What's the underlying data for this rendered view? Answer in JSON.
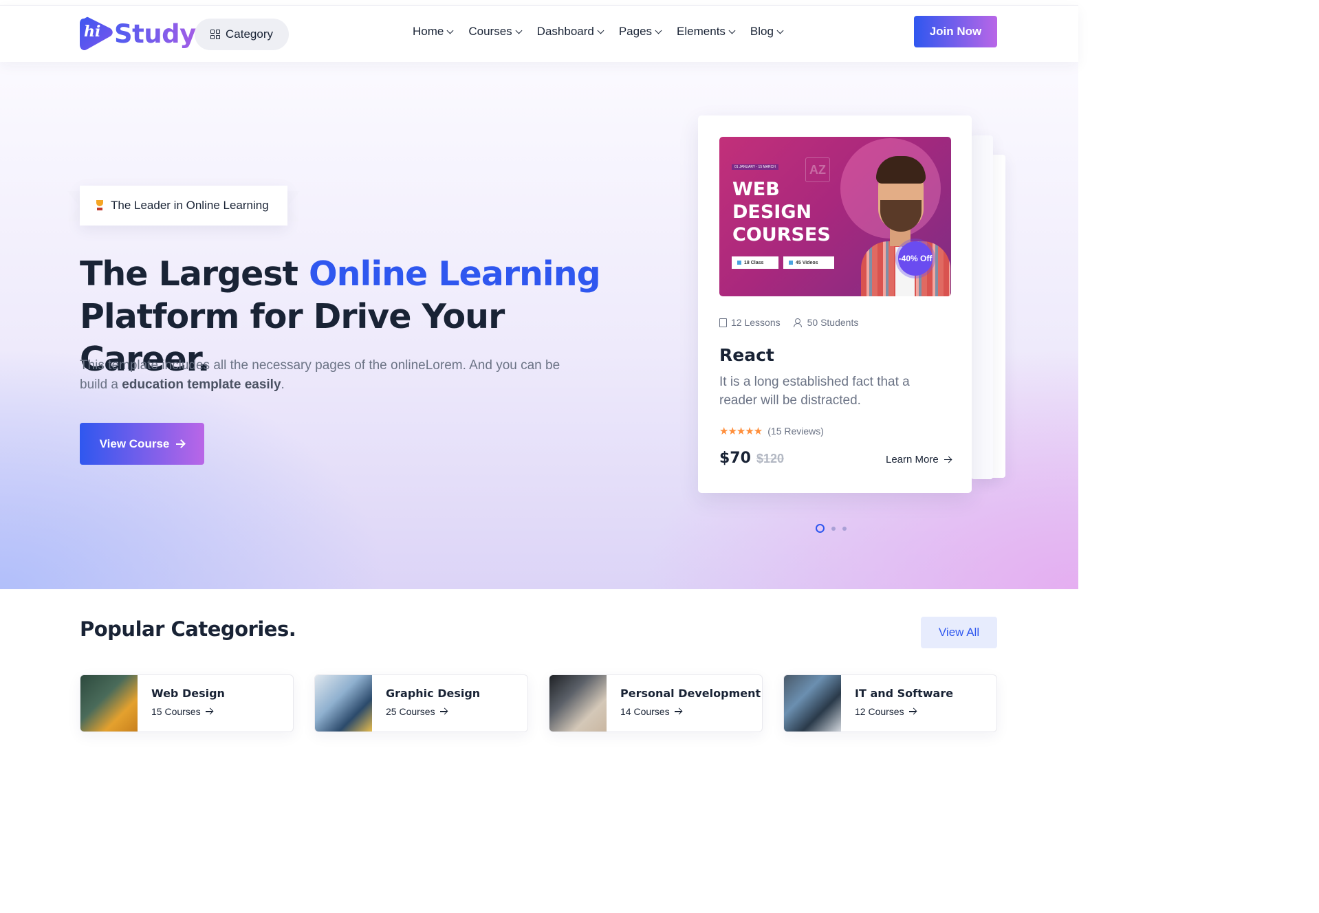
{
  "header": {
    "logo_text": "Study",
    "logo_badge": "hi",
    "category_label": "Category",
    "menu": [
      {
        "label": "Home"
      },
      {
        "label": "Courses"
      },
      {
        "label": "Dashboard"
      },
      {
        "label": "Pages"
      },
      {
        "label": "Elements"
      },
      {
        "label": "Blog"
      }
    ],
    "join_label": "Join Now"
  },
  "hero": {
    "badge": "The Leader in Online Learning",
    "title_part1": "The Largest ",
    "title_highlight": "Online Learning",
    "title_part2": "Platform for Drive Your Career.",
    "desc_part1": "This template includes all the necessary pages of the onlineLorem. And you can be build a ",
    "desc_bold": "education template easily",
    "desc_part2": ".",
    "cta_label": "View Course"
  },
  "course_card": {
    "thumb": {
      "date": "01 JANUARY - 15 MARCH",
      "az": "AZ",
      "title": "WEB DESIGN COURSES",
      "tag1": "18 Class",
      "tag2": "45 Videos",
      "discount": "-40% Off"
    },
    "lessons": "12 Lessons",
    "students": "50 Students",
    "title": "React",
    "description": "It is a long established fact that a reader will be distracted.",
    "stars": "★★★★★",
    "rating": 5,
    "reviews": "(15 Reviews)",
    "price": "$70",
    "old_price": "$120",
    "learn_more": "Learn More"
  },
  "carousel": {
    "count": 3,
    "active": 0
  },
  "categories_section": {
    "title": "Popular Categories.",
    "view_all": "View All",
    "items": [
      {
        "name": "Web Design",
        "count": "15 Courses"
      },
      {
        "name": "Graphic Design",
        "count": "25 Courses"
      },
      {
        "name": "Personal Development",
        "count": "14 Courses"
      },
      {
        "name": "IT and Software",
        "count": "12 Courses"
      }
    ]
  },
  "colors": {
    "accent": "#2f57ef",
    "accent_gradient_end": "#b966e7",
    "heading": "#192335",
    "body": "#6b7385",
    "star": "#ff8f3c"
  }
}
